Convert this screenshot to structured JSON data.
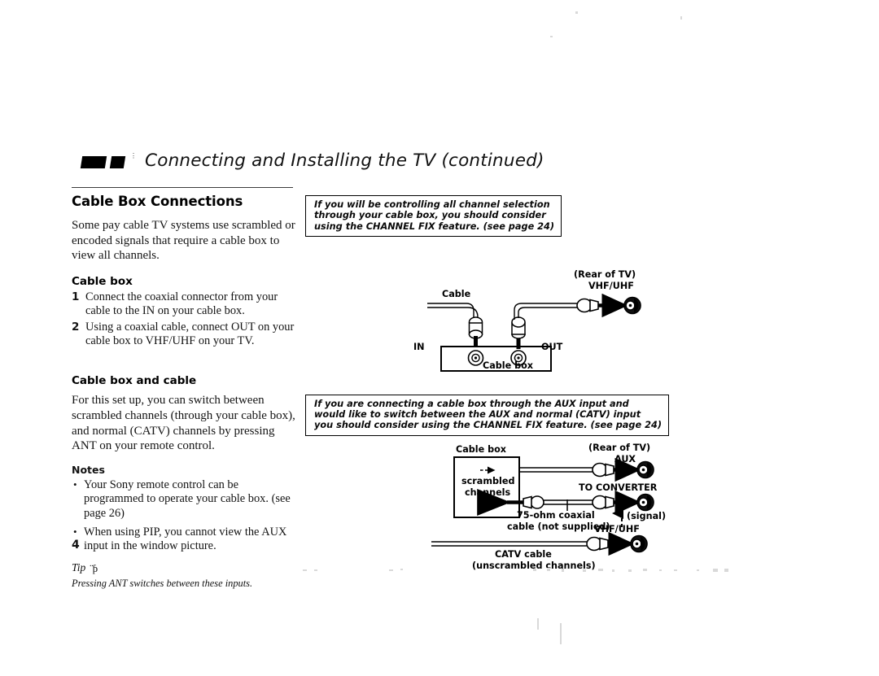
{
  "header": {
    "title": "Connecting and Installing the TV (continued)",
    "mark_icon": "black-bars-icon"
  },
  "left_column": {
    "section_title": "Cable Box Connections",
    "intro": "Some pay cable TV systems use scrambled or encoded signals that require a cable box to view all channels.",
    "subsection_1": {
      "title": "Cable box",
      "steps": [
        {
          "num": "1",
          "text": "Connect the coaxial connector from your cable to the IN on your cable box."
        },
        {
          "num": "2",
          "text": "Using a coaxial cable, connect OUT on your cable box to VHF/UHF on your TV."
        }
      ]
    },
    "subsection_2": {
      "title": "Cable box and cable",
      "body": "For this set up, you can switch between scrambled channels (through your cable box), and normal (CATV) channels by pressing ANT on your remote control.",
      "notes_title": "Notes",
      "notes": [
        "Your Sony remote control can be programmed to operate your cable box. (see page 26)",
        "When using PIP, you cannot view the AUX input in the window picture."
      ],
      "tip_label": "Tip",
      "tip_icon": "lightbulb-icon",
      "tip_text": "Pressing ANT switches between these inputs."
    }
  },
  "page_number": "4",
  "diagram_1": {
    "callout": [
      "If you will be controlling all channel selection",
      "through your cable box, you should consider",
      "using the CHANNEL FIX feature. (see page 24)"
    ],
    "labels": {
      "cable": "Cable",
      "rear_of_tv": "(Rear of TV)",
      "vhf_uhf": "VHF/UHF",
      "in": "IN",
      "out": "OUT",
      "cable_box": "Cable box"
    }
  },
  "diagram_2": {
    "callout": [
      "If you are connecting a cable box through the AUX input and",
      "would like to switch between the AUX and normal (CATV) input",
      "you should consider using the CHANNEL FIX feature. (see page 24)"
    ],
    "labels": {
      "cable_box": "Cable box",
      "scrambled": "scrambled",
      "channels": "channels",
      "rear_of_tv": "(Rear of TV)",
      "aux": "AUX",
      "to_converter": "TO CONVERTER",
      "signal": "(signal)",
      "vhf_uhf": "VHF/UHF",
      "coax_line1": "75-ohm coaxial",
      "coax_line2": "cable (not supplied)",
      "catv_line1": "CATV cable",
      "catv_line2": "(unscrambled channels)"
    }
  },
  "colors": {
    "ink": "#111111",
    "rule": "#3b3b3b",
    "paper": "#ffffff"
  }
}
